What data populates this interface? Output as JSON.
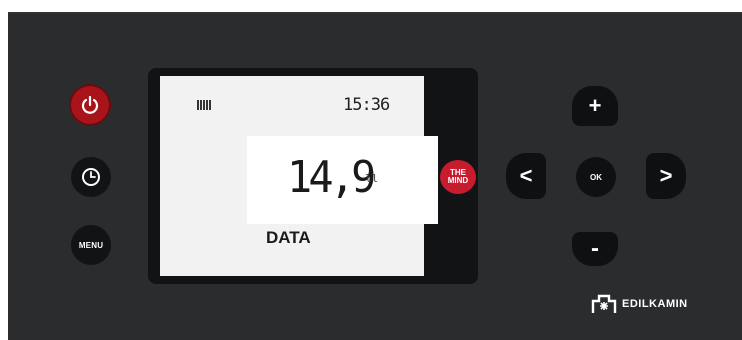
{
  "display": {
    "time": "15:36",
    "value": "14,9",
    "unit_mark": "ll",
    "label": "DATA"
  },
  "buttons": {
    "power_icon": "power-icon",
    "clock_icon": "clock-icon",
    "menu_label": "MENU"
  },
  "logo": {
    "the_mind_line1": "THE",
    "the_mind_line2": "MIND"
  },
  "nav": {
    "up_label": "+",
    "down_label": "-",
    "left_label": "<",
    "right_label": ">",
    "ok_label": "OK"
  },
  "brand": {
    "name": "EDILKAMIN",
    "icon": "edilkamin-logo-icon"
  },
  "colors": {
    "panel": "#2b2c2e",
    "power": "#a9141b",
    "screen": "#f2f2f2"
  }
}
